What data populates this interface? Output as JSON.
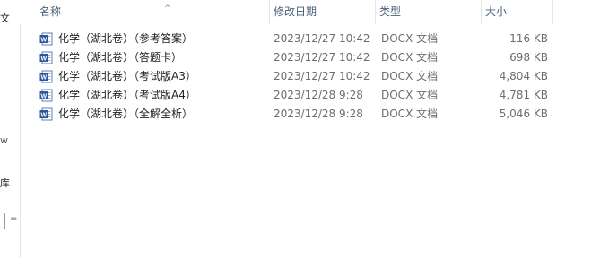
{
  "nav": {
    "fragments": [
      "文",
      "w",
      "库",
      "="
    ]
  },
  "header": {
    "name": "名称",
    "date": "修改日期",
    "type": "类型",
    "size": "大小"
  },
  "files": [
    {
      "name": "化学（湖北卷）（参考答案）",
      "date": "2023/12/27 10:42",
      "type": "DOCX 文档",
      "size": "116 KB",
      "icon": "word-doc-icon"
    },
    {
      "name": "化学（湖北卷）（答题卡）",
      "date": "2023/12/27 10:42",
      "type": "DOCX 文档",
      "size": "698 KB",
      "icon": "word-doc-icon"
    },
    {
      "name": "化学（湖北卷）（考试版A3）",
      "date": "2023/12/27 10:42",
      "type": "DOCX 文档",
      "size": "4,804 KB",
      "icon": "word-doc-icon"
    },
    {
      "name": "化学（湖北卷）（考试版A4）",
      "date": "2023/12/28 9:28",
      "type": "DOCX 文档",
      "size": "4,781 KB",
      "icon": "word-doc-icon"
    },
    {
      "name": "化学（湖北卷）（全解全析）",
      "date": "2023/12/28 9:28",
      "type": "DOCX 文档",
      "size": "5,046 KB",
      "icon": "word-doc-icon"
    }
  ],
  "colors": {
    "header_text": "#4c607a",
    "icon_blue": "#2b579a"
  }
}
